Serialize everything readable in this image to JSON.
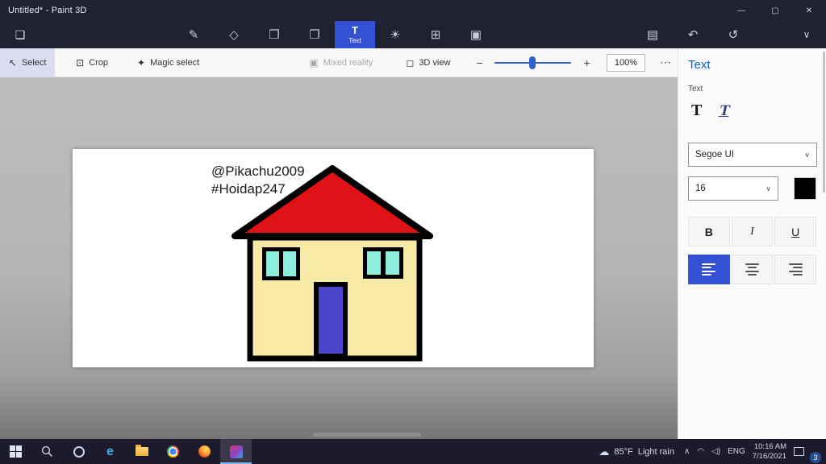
{
  "colors": {
    "titlebar_bg": "#212134",
    "taskbar_bg": "#1b1b2d",
    "accent": "#3450d4",
    "heading_blue": "#0065d9",
    "select_highlight": "#d9ddef",
    "slider_blue": "#2f5fd0",
    "roof": "#e01217",
    "wall": "#f7e9a6",
    "window_pane": "#8deede",
    "door": "#4a45cb",
    "outline": "#000000",
    "canvas_text": "#1a1a1a"
  },
  "window": {
    "title": "Untitled* - Paint 3D",
    "minimize": "—",
    "maximize": "▢",
    "close": "✕"
  },
  "toolbar": {
    "menu_icon": "❏",
    "tools": {
      "brushes": "✎",
      "shapes2d": "◇",
      "shapes3d": "❒",
      "stickers": "❐",
      "text": "T",
      "text_label": "Text",
      "effects": "☀",
      "canvas": "⊞",
      "library3d": "▣"
    },
    "right": {
      "paste": "▤",
      "undo": "↶",
      "history": "↺",
      "expand": "∨"
    }
  },
  "subtoolbar": {
    "select": {
      "icon": "↖",
      "label": "Select"
    },
    "crop": {
      "icon": "⊡",
      "label": "Crop"
    },
    "magic": {
      "icon": "✦",
      "label": "Magic select"
    },
    "mixed_reality": {
      "icon": "▣",
      "label": "Mixed reality"
    },
    "view3d": {
      "icon": "◻",
      "label": "3D view"
    },
    "zoom_out": "−",
    "zoom_in": "+",
    "zoom_value": "100%",
    "more": "⋯"
  },
  "canvas": {
    "text_line1": "@Pikachu2009",
    "text_line2": "#Hoidap247"
  },
  "panel": {
    "title": "Text",
    "section_label": "Text",
    "text2d": "T",
    "text3d": "T",
    "font": "Segoe UI",
    "size": "16",
    "chevron": "∨",
    "bold": "B",
    "italic": "I",
    "underline": "U"
  },
  "taskbar": {
    "icons": {
      "edge": "e"
    },
    "weather_temp": "85°F",
    "weather_desc": "Light rain",
    "tray": {
      "expand": "∧",
      "network": "◠",
      "volume": "◁)"
    },
    "lang": "ENG",
    "time": "10:16 AM",
    "date": "7/16/2021",
    "badge": "3"
  }
}
